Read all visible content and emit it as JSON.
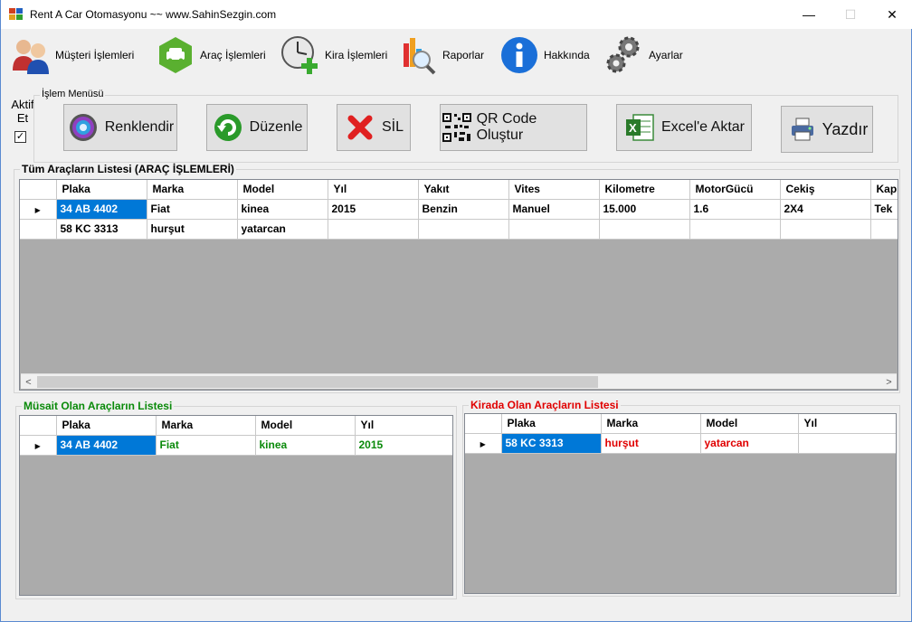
{
  "window": {
    "title": "Rent A Car Otomasyonu ~~ www.SahinSezgin.com",
    "min_glyph": "—",
    "max_glyph": "☐",
    "close_glyph": "✕"
  },
  "menu": [
    {
      "label": "Müşteri İşlemleri",
      "icon": "customers-icon"
    },
    {
      "label": "Araç İşlemleri",
      "icon": "car-icon"
    },
    {
      "label": "Kira İşlemleri",
      "icon": "clock-add-icon"
    },
    {
      "label": "Raporlar",
      "icon": "report-chart-icon"
    },
    {
      "label": "Hakkında",
      "icon": "info-icon"
    },
    {
      "label": "Ayarlar",
      "icon": "gears-icon"
    }
  ],
  "aktif": {
    "label": "Aktif Et",
    "checked_glyph": "✓"
  },
  "islem_menusu": {
    "legend": "İşlem Menüsü",
    "buttons": [
      {
        "label": "Renklendir",
        "icon": "color-wheel-icon"
      },
      {
        "label": "Düzenle",
        "icon": "refresh-icon"
      },
      {
        "label": "SİL",
        "icon": "delete-x-icon"
      },
      {
        "label": "QR Code Oluştur",
        "icon": "qr-code-icon"
      },
      {
        "label": "Excel'e Aktar",
        "icon": "excel-icon"
      },
      {
        "label": "Yazdır",
        "icon": "printer-icon"
      }
    ]
  },
  "all_cars": {
    "legend": "Tüm Araçların Listesi (ARAÇ İŞLEMLERİ)",
    "columns": [
      "Plaka",
      "Marka",
      "Model",
      "Yıl",
      "Yakıt",
      "Vites",
      "Kilometre",
      "MotorGücü",
      "Cekiş",
      "Kapı"
    ],
    "rows": [
      [
        "34 AB 4402",
        "Fiat",
        "kinea",
        "2015",
        "Benzin",
        "Manuel",
        "15.000",
        "1.6",
        "2X4",
        "Tek"
      ],
      [
        "58 KC 3313",
        "hurşut",
        "yatarcan",
        "",
        "",
        "",
        "",
        "",
        "",
        ""
      ]
    ],
    "scroll_left": "<",
    "scroll_right": ">"
  },
  "available_cars": {
    "legend": "Müsait Olan Araçların  Listesi",
    "columns": [
      "Plaka",
      "Marka",
      "Model",
      "Yıl"
    ],
    "rows": [
      [
        "34 AB 4402",
        "Fiat",
        "kinea",
        "2015"
      ]
    ]
  },
  "rented_cars": {
    "legend": "Kirada Olan Araçların Listesi",
    "columns": [
      "Plaka",
      "Marka",
      "Model",
      "Yıl"
    ],
    "rows": [
      [
        "58 KC 3313",
        "hurşut",
        "yatarcan",
        ""
      ]
    ]
  }
}
